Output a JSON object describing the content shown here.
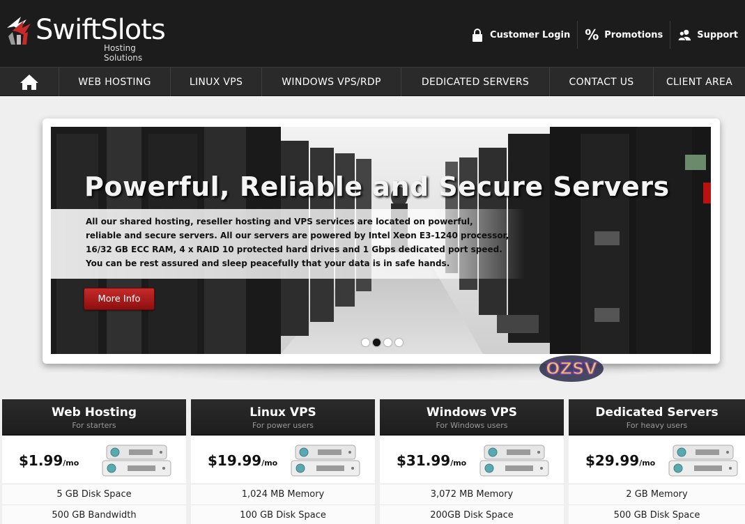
{
  "brand": {
    "name": "SwiftSlots",
    "tagline": "Hosting Solutions"
  },
  "toplinks": [
    {
      "label": "Customer Login",
      "icon": "lock-icon"
    },
    {
      "label": "Promotions",
      "icon": "percent-icon"
    },
    {
      "label": "Support",
      "icon": "users-icon"
    }
  ],
  "nav": {
    "home_icon": "home-icon",
    "items": [
      "WEB HOSTING",
      "LINUX VPS",
      "WINDOWS VPS/RDP",
      "DEDICATED SERVERS",
      "CONTACT US",
      "CLIENT AREA"
    ]
  },
  "slider": {
    "title": "Powerful, Reliable and Secure Servers",
    "text": "All our shared hosting, reseller hosting and VPS services are located on powerful, reliable and secure servers. All our servers are powered by Intel Xeon E3-1240 processor, 16/32 GB ECC RAM, 4 x RAID 10 protected hard drives and 1 Gbps dedicated port speed. You can be rest assured and sleep peacefully that your data is in safe hands.",
    "button": "More Info",
    "dots": 4,
    "active_dot": 2
  },
  "sticker": "OZSV",
  "plans": [
    {
      "title": "Web Hosting",
      "subtitle": "For starters",
      "price": "$1.99",
      "per": "/mo",
      "features": [
        "5 GB Disk Space",
        "500 GB Bandwidth"
      ]
    },
    {
      "title": "Linux VPS",
      "subtitle": "For power users",
      "price": "$19.99",
      "per": "/mo",
      "features": [
        "1,024 MB Memory",
        "100 GB Disk Space"
      ]
    },
    {
      "title": "Windows VPS",
      "subtitle": "For Windows users",
      "price": "$31.99",
      "per": "/mo",
      "features": [
        "3,072 MB Memory",
        "200GB Disk Space"
      ]
    },
    {
      "title": "Dedicated Servers",
      "subtitle": "For heavy users",
      "price": "$29.99",
      "per": "/mo",
      "features": [
        "2 GB Memory",
        "500 GB Disk Space"
      ]
    }
  ],
  "colors": {
    "header_bg": "#1c1c1c",
    "nav_bg": "#2a2a2a",
    "button_red": "#b41f1f",
    "page_bg": "#efefef"
  }
}
